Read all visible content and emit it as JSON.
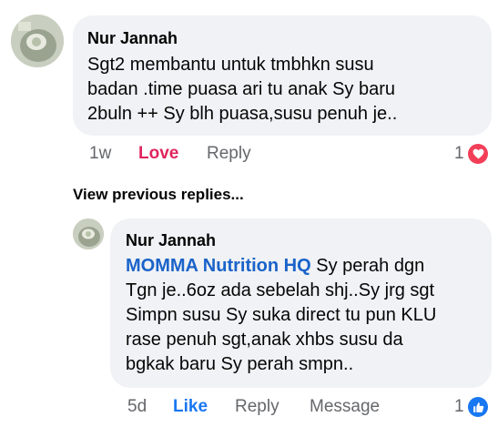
{
  "comment": {
    "author": "Nur Jannah",
    "text_lines": [
      "Sgt2 membantu untuk tmbhkn susu",
      "badan .time puasa ari tu anak Sy baru",
      "2buln ++ Sy blh puasa,susu penuh je.."
    ],
    "time": "1w",
    "reaction_label": "Love",
    "reply_label": "Reply",
    "reaction_count": "1",
    "reaction_icon": "heart-icon",
    "reaction_color": "#f33e58"
  },
  "view_previous": "View previous replies...",
  "reply": {
    "author": "Nur Jannah",
    "mention": "MOMMA Nutrition HQ",
    "text_first": " Sy perah dgn",
    "text_lines": [
      "Tgn je..6oz ada sebelah shj..Sy jrg sgt",
      "Simpn susu Sy suka direct tu pun KLU",
      "rase penuh sgt,anak xhbs susu da",
      "bgkak baru Sy perah smpn.."
    ],
    "time": "5d",
    "reaction_label": "Like",
    "reply_label": "Reply",
    "message_label": "Message",
    "reaction_count": "1",
    "reaction_icon": "thumbs-up-icon",
    "reaction_color": "#1877f2"
  }
}
